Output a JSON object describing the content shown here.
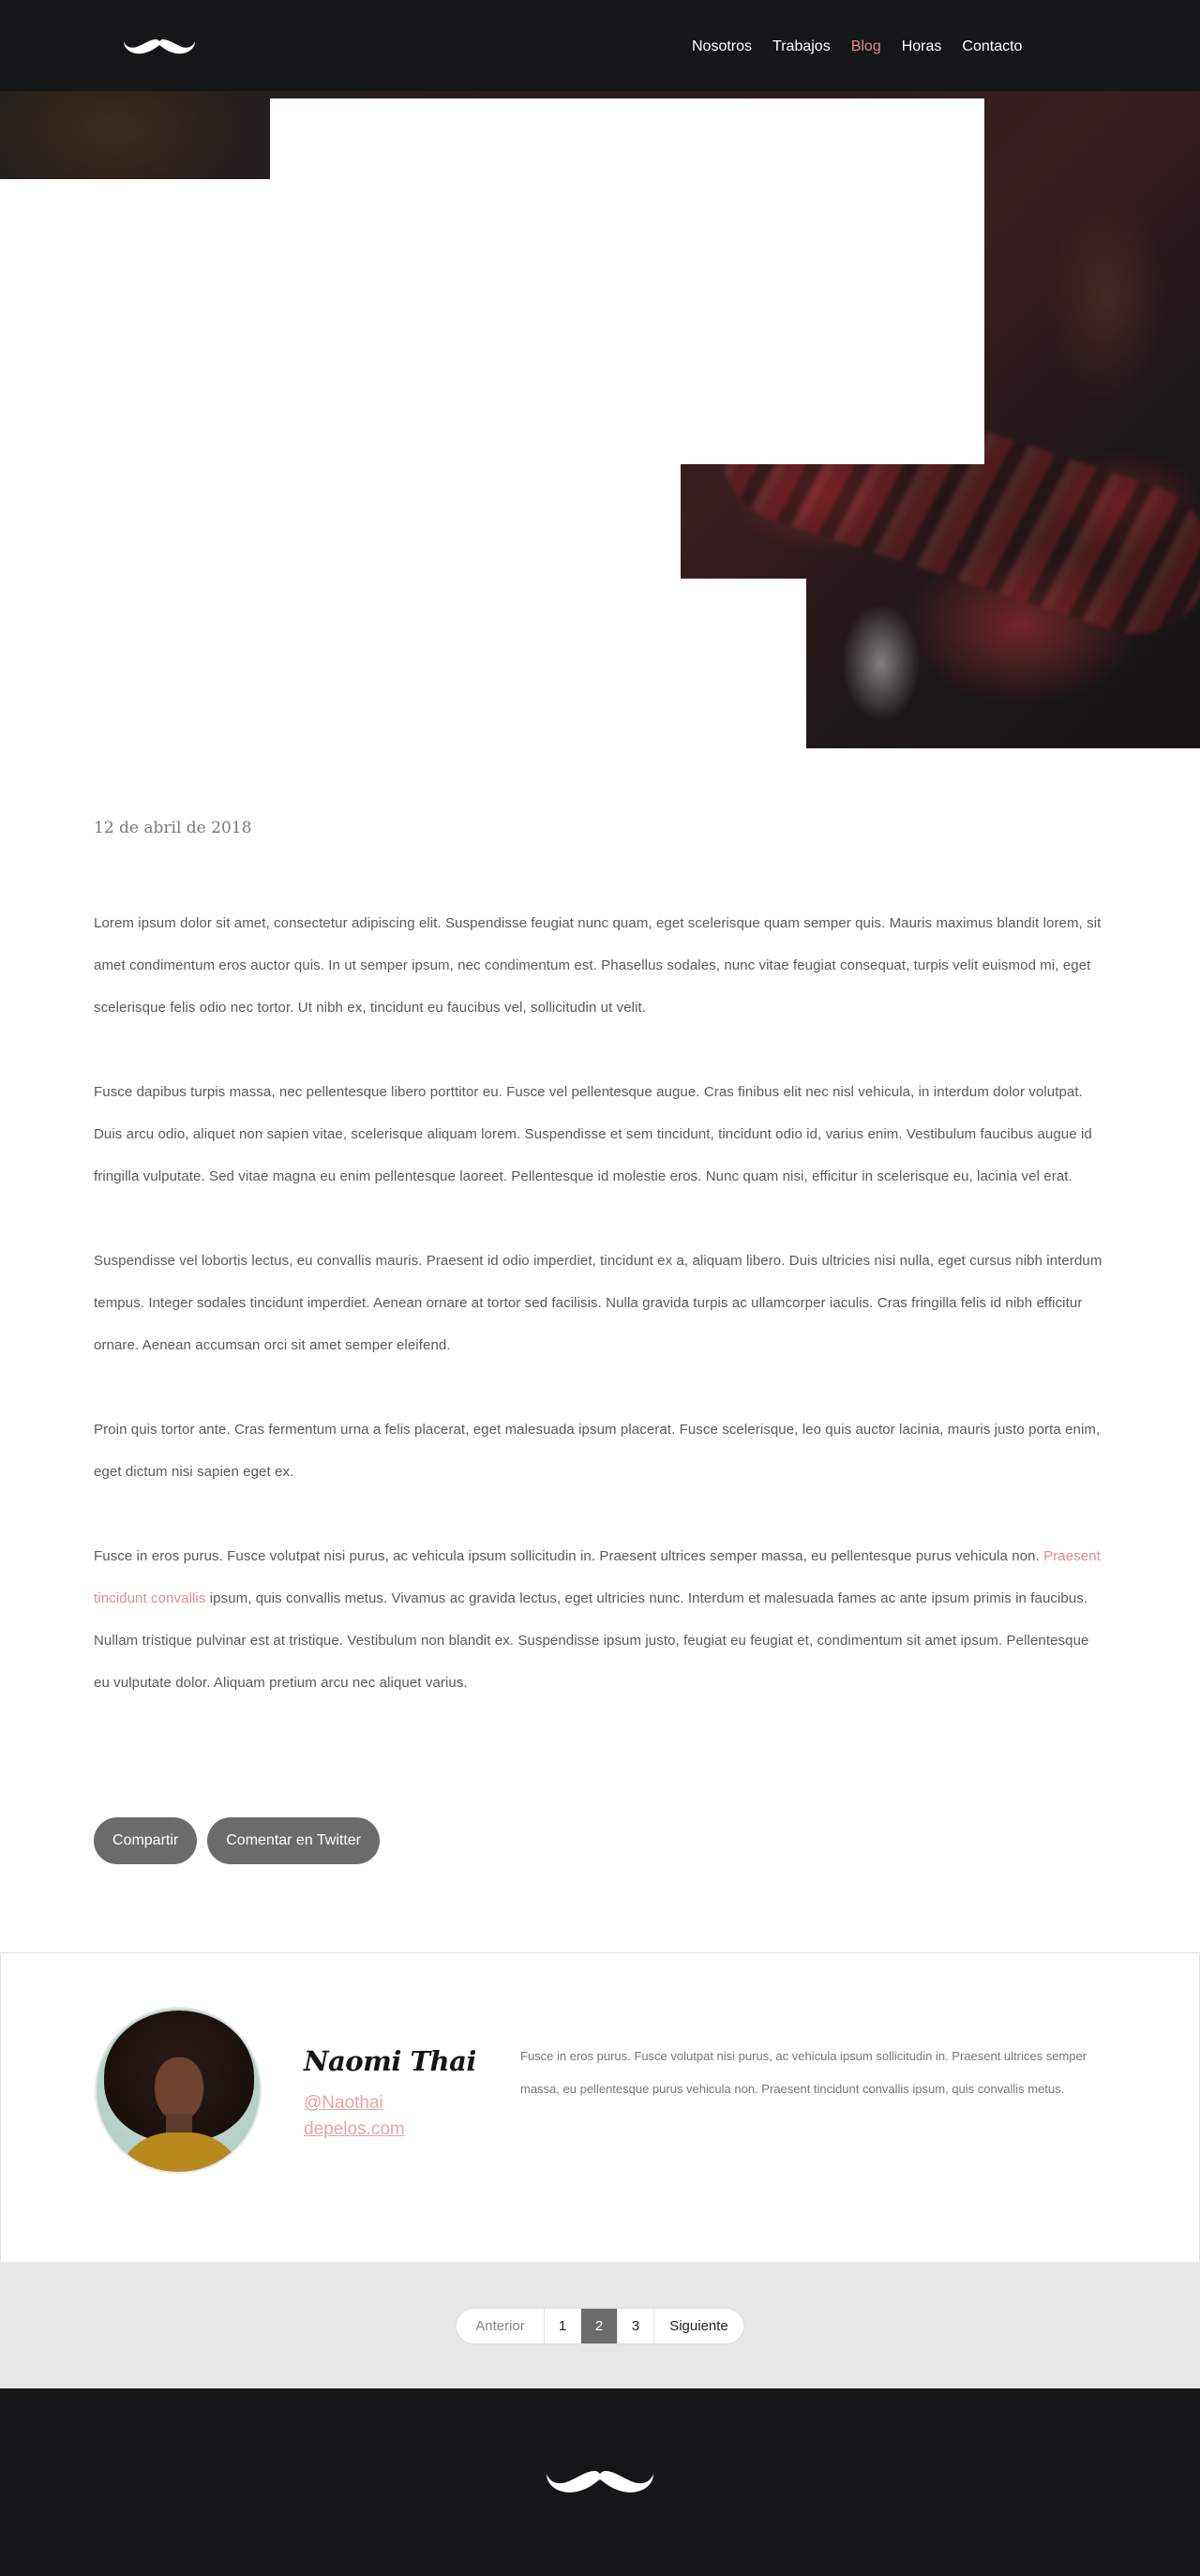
{
  "nav": {
    "items": [
      {
        "label": "Nosotros",
        "active": false
      },
      {
        "label": "Trabajos",
        "active": false
      },
      {
        "label": "Blog",
        "active": true
      },
      {
        "label": "Horas",
        "active": false
      },
      {
        "label": "Contacto",
        "active": false
      }
    ]
  },
  "colors": {
    "accent": "#e38b8f",
    "dark": "#141618",
    "button": "#6b6b6b",
    "band": "#e7e7e6"
  },
  "icons": {
    "header_logo": "mustache-icon",
    "footer_logo": "mustache-icon"
  },
  "post": {
    "date": "12 de abril de 2018",
    "paragraphs": [
      {
        "text": "Lorem ipsum dolor sit amet, consectetur adipiscing elit. Suspendisse feugiat nunc quam, eget scelerisque quam semper quis. Mauris maximus blandit lorem, sit amet condimentum eros auctor quis. In ut semper ipsum, nec condimentum est. Phasellus sodales, nunc vitae feugiat consequat, turpis velit euismod mi, eget scelerisque felis odio nec tortor. Ut nibh ex, tincidunt eu faucibus vel, sollicitudin ut velit."
      },
      {
        "text": "Fusce dapibus turpis massa, nec pellentesque libero porttitor eu. Fusce vel pellentesque augue. Cras finibus elit nec nisl vehicula, in interdum dolor volutpat. Duis arcu odio, aliquet non sapien vitae, scelerisque aliquam lorem. Suspendisse et sem tincidunt, tincidunt odio id, varius enim. Vestibulum faucibus augue id fringilla vulputate. Sed vitae magna eu enim pellentesque laoreet. Pellentesque id molestie eros. Nunc quam nisi, efficitur in scelerisque eu, lacinia vel erat."
      },
      {
        "text": "Suspendisse vel lobortis lectus, eu convallis mauris. Praesent id odio imperdiet, tincidunt ex a, aliquam libero. Duis ultricies nisi nulla, eget cursus nibh interdum tempus. Integer sodales tincidunt imperdiet. Aenean ornare at tortor sed facilisis. Nulla gravida turpis ac ullamcorper iaculis. Cras fringilla felis id nibh efficitur ornare. Aenean accumsan orci sit amet semper eleifend."
      },
      {
        "text": "Proin quis tortor ante. Cras fermentum urna a felis placerat, eget malesuada ipsum placerat. Fusce scelerisque, leo quis auctor lacinia, mauris justo porta enim, eget dictum nisi sapien eget ex."
      }
    ],
    "last_paragraph": {
      "before": "Fusce in eros purus. Fusce volutpat nisi purus, ac vehicula ipsum sollicitudin in. Praesent ultrices semper massa, eu pellentesque purus vehicula non. ",
      "link": "Praesent tincidunt convallis",
      "after": " ipsum, quis convallis metus. Vivamus ac gravida lectus, eget ultricies nunc. Interdum et malesuada fames ac ante ipsum primis in faucibus. Nullam tristique pulvinar est at tristique. Vestibulum non blandit ex. Suspendisse ipsum justo, feugiat eu feugiat et, condimentum sit amet ipsum. Pellentesque eu vulputate dolor. Aliquam pretium arcu nec aliquet varius."
    },
    "share_label": "Compartir",
    "twitter_label": "Comentar en Twitter"
  },
  "author": {
    "name": "Naomi Thai",
    "handle": "@Naothai",
    "site": "depelos.com",
    "bio": "Fusce in eros purus. Fusce volutpat nisi purus, ac vehicula ipsum sollicitudin in. Praesent ultrices semper massa, eu pellentesque purus vehicula non. Praesent tincidunt convallis ipsum, quis convallis metus."
  },
  "pagination": {
    "prev": "Anterior",
    "pages": [
      "1",
      "2",
      "3"
    ],
    "current": "2",
    "next": "Siguiente"
  }
}
